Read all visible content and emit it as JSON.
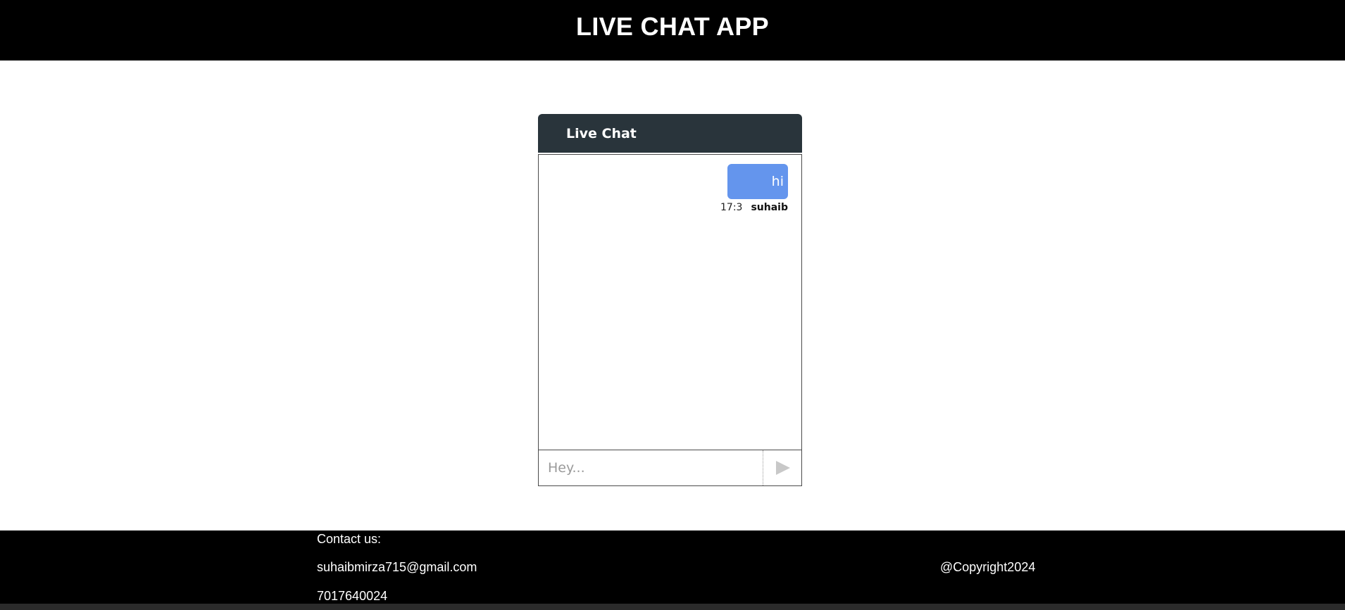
{
  "header": {
    "title": "LIVE CHAT APP"
  },
  "chat": {
    "title": "Live Chat",
    "messages": [
      {
        "text": "hi",
        "time": "17:3",
        "user": "suhaib"
      }
    ],
    "input": {
      "placeholder": "Hey...",
      "value": ""
    },
    "send_icon": "play-triangle-icon"
  },
  "footer": {
    "contact_label": "Contact us:",
    "email": "suhaibmirza715@gmail.com",
    "phone": "7017640024",
    "copyright": "@Copyright2024"
  },
  "colors": {
    "header_bg": "#000000",
    "chat_header_bg": "#29343b",
    "bubble_bg": "#6495ed",
    "footer_bg": "#000000"
  }
}
